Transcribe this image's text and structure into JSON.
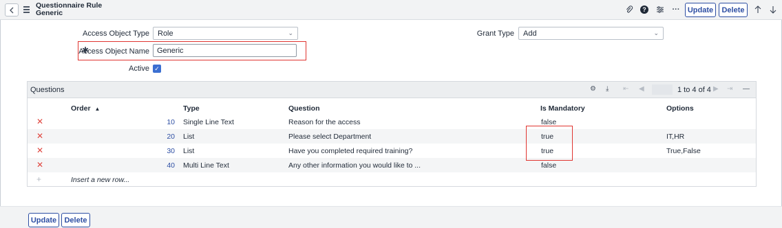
{
  "header": {
    "title": "Questionnaire Rule",
    "subtitle": "Generic",
    "back_icon": "back-icon",
    "menu_icon": "hamburger-icon",
    "attach_icon": "paperclip-icon",
    "help_icon_text": "?",
    "settings_icon": "sliders-icon",
    "more_icon": "more-icon",
    "update_label": "Update",
    "delete_label": "Delete",
    "up_icon": "arrow-up-icon",
    "down_icon": "arrow-down-icon"
  },
  "form": {
    "access_object_type_label": "Access Object Type",
    "access_object_type_value": "Role",
    "access_object_name_label": "Access Object Name",
    "access_object_name_value": "Generic",
    "active_label": "Active",
    "active_checked": true,
    "grant_type_label": "Grant Type",
    "grant_type_value": "Add"
  },
  "questions": {
    "title": "Questions",
    "pager_text": "1  to 4 of 4",
    "columns": {
      "order": "Order",
      "type": "Type",
      "question": "Question",
      "is_mandatory": "Is Mandatory",
      "options": "Options"
    },
    "sort_indicator": "▲",
    "rows": [
      {
        "order": "10",
        "type": "Single Line Text",
        "question": "Reason for the access",
        "is_mandatory": "false",
        "options": ""
      },
      {
        "order": "20",
        "type": "List",
        "question": "Please select Department",
        "is_mandatory": "true",
        "options": "IT,HR"
      },
      {
        "order": "30",
        "type": "List",
        "question": "Have you completed required training?",
        "is_mandatory": "true",
        "options": "True,False"
      },
      {
        "order": "40",
        "type": "Multi Line Text",
        "question": "Any other information you would like to ...",
        "is_mandatory": "false",
        "options": ""
      }
    ],
    "insert_row_label": "Insert a new row..."
  },
  "footer": {
    "update_label": "Update",
    "delete_label": "Delete"
  },
  "colors": {
    "accent": "#2d4ea3",
    "highlight": "#e0342f",
    "delete_x": "#e0463f"
  }
}
